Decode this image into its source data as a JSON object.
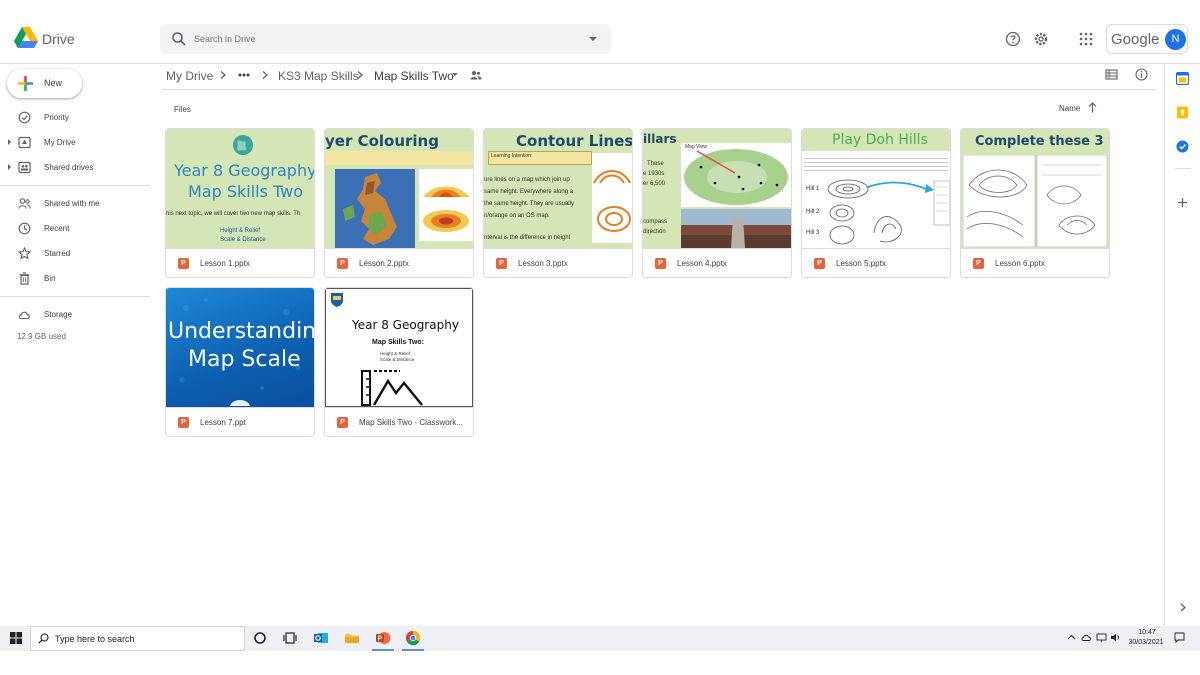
{
  "app": {
    "name": "Drive"
  },
  "search": {
    "placeholder": "Search in Drive"
  },
  "account": {
    "brand": "Google",
    "avatar_letter": "N"
  },
  "nav": {
    "new_label": "New",
    "items": [
      {
        "label": "Priority",
        "icon": "check-circle-icon"
      },
      {
        "label": "My Drive",
        "icon": "drive-folder-icon"
      },
      {
        "label": "Shared drives",
        "icon": "shared-drives-icon"
      },
      {
        "label": "Shared with me",
        "icon": "people-icon"
      },
      {
        "label": "Recent",
        "icon": "clock-icon"
      },
      {
        "label": "Starred",
        "icon": "star-icon"
      },
      {
        "label": "Bin",
        "icon": "trash-icon"
      },
      {
        "label": "Storage",
        "icon": "cloud-icon"
      }
    ],
    "storage_used": "12.9 GB used"
  },
  "breadcrumb": {
    "root": "My Drive",
    "parent": "KS3 Map Skills",
    "current": "Map Skills Two"
  },
  "list": {
    "section_label": "Files",
    "sort_label": "Name"
  },
  "files": [
    {
      "name": "Lesson 1.pptx",
      "thumb": {
        "title_line1": "Year 8 Geography",
        "title_line2": "Map Skills Two",
        "body": "his next topic, we will cover two new map skills. Th",
        "bullet1": "Height & Relief",
        "bullet2": "Scale & Distance"
      }
    },
    {
      "name": "Lesson 2.pptx",
      "thumb": {
        "title": "yer Colouring"
      }
    },
    {
      "name": "Lesson 3.pptx",
      "thumb": {
        "title": "Contour Lines",
        "box_label": "Learning Intention:",
        "line1": "ure lines on a map which join up",
        "line2": "same height. Everywhere along a",
        "line3": "the same height. They are usually",
        "line4": "n/orange on an OS map.",
        "line5": "nterval is the difference in height"
      }
    },
    {
      "name": "Lesson 4.pptx",
      "thumb": {
        "title": "illars",
        "map_label": "Map View",
        "side1": "These",
        "side2": "e 1930s",
        "side3": "er 6,500",
        "side4": "compass",
        "side5": "direction"
      }
    },
    {
      "name": "Lesson 5.pptx",
      "thumb": {
        "title": "Play Doh Hills",
        "hill1": "Hill 1",
        "hill2": "Hill 2",
        "hill3": "Hill 3"
      }
    },
    {
      "name": "Lesson 6.pptx",
      "thumb": {
        "title": "Complete these 3 w"
      }
    },
    {
      "name": "Lesson 7.ppt",
      "thumb": {
        "title_line1": "Understanding",
        "title_line2": "Map Scale"
      }
    },
    {
      "name": "Map Skills Two - Classwork...",
      "thumb": {
        "title": "Year 8 Geography",
        "subtitle": "Map Skills Two:",
        "bullet1": "Height & Relief",
        "bullet2": "Scale & Distance"
      }
    }
  ],
  "taskbar": {
    "search_label": "Type here to search",
    "time": "10:47",
    "date": "30/03/2021"
  },
  "colors": {
    "accent": "#1a73e8",
    "ppt": "#e8623a",
    "slide_green": "#d4e6b5"
  }
}
